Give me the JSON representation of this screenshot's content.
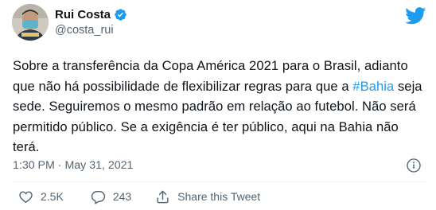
{
  "author": {
    "display_name": "Rui Costa",
    "handle": "@costa_rui",
    "verified": true
  },
  "tweet": {
    "text_parts": {
      "before_hashtag": "Sobre a transferência da Copa América 2021 para o Brasil, adianto que não há possibilidade de flexibilizar regras para que a ",
      "hashtag": "#Bahia",
      "after_hashtag": " seja sede. Seguiremos o mesmo padrão em relação ao futebol. Não será permitido público. Se a exigência é ter público, aqui na Bahia não terá."
    },
    "timestamp": "1:30 PM · May 31, 2021"
  },
  "actions": {
    "likes": "2.5K",
    "replies": "243",
    "share_label": "Share this Tweet"
  },
  "icons": {
    "brand": "twitter-bird-icon",
    "verified": "verified-badge-icon",
    "info": "info-icon",
    "like": "heart-icon",
    "reply": "reply-bubble-icon",
    "share": "share-icon"
  },
  "colors": {
    "brand_blue": "#1d9bf0",
    "text_primary": "#0f1419",
    "text_secondary": "#536471",
    "divider": "#eff3f4"
  }
}
